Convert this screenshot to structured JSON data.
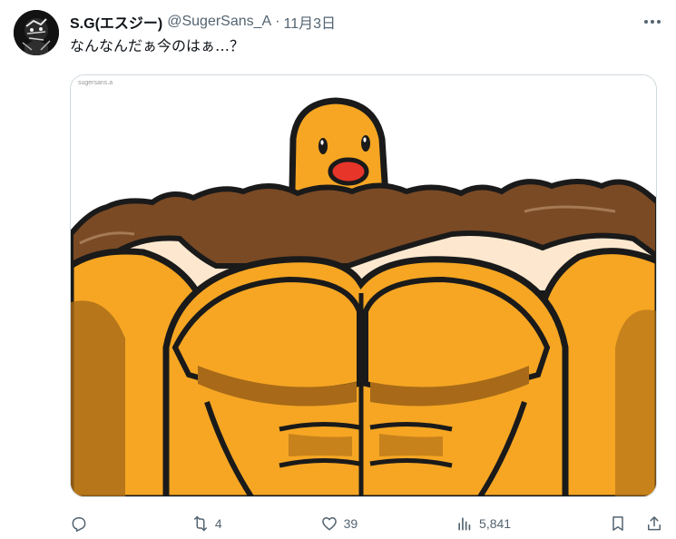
{
  "tweet": {
    "display_name": "S.G(エスジー)",
    "handle": "@SugerSans_A",
    "separator": "·",
    "time": "11月3日",
    "text": "なんなんだぁ今のはぁ…？",
    "image": {
      "watermark": "sugersans.a",
      "subject": "muscular-cartoon-character"
    }
  },
  "actions": {
    "reply": {
      "icon": "reply-icon",
      "count": ""
    },
    "repost": {
      "icon": "repost-icon",
      "count": "4"
    },
    "like": {
      "icon": "heart-icon",
      "count": "39"
    },
    "views": {
      "icon": "views-icon",
      "count": "5,841"
    },
    "bookmark": {
      "icon": "bookmark-icon"
    },
    "share": {
      "icon": "share-icon"
    }
  },
  "colors": {
    "text_primary": "#0f1419",
    "text_secondary": "#536471",
    "border": "#cfd9de",
    "skin": "#f6a623",
    "skin_shadow": "#a86a18",
    "outline": "#1a1a1a",
    "fur": "#7a4a25",
    "cream": "#fde8cf"
  }
}
